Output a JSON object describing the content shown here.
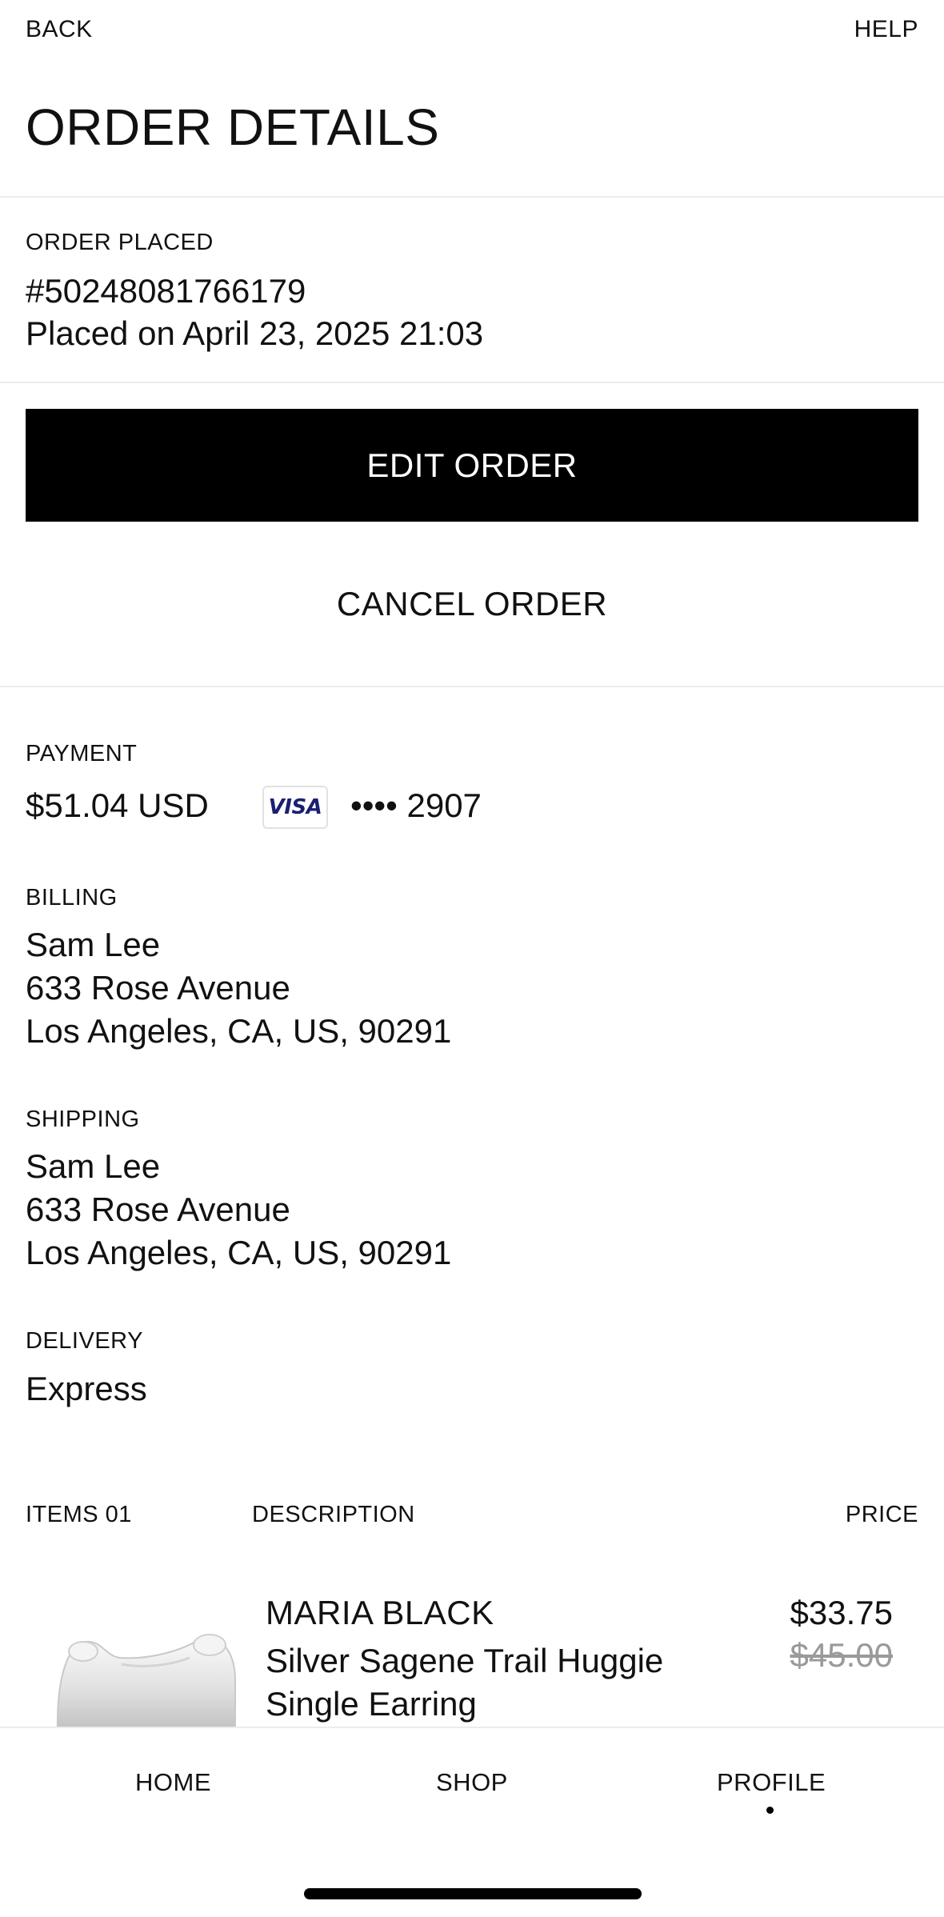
{
  "header": {
    "back_label": "BACK",
    "help_label": "HELP",
    "title": "ORDER DETAILS"
  },
  "order": {
    "section_label": "ORDER PLACED",
    "number": "#50248081766179",
    "placed_on": "Placed on April 23, 2025 21:03"
  },
  "actions": {
    "edit_label": "EDIT ORDER",
    "cancel_label": "CANCEL ORDER"
  },
  "payment": {
    "section_label": "PAYMENT",
    "amount": "$51.04 USD",
    "card_brand": "VISA",
    "card_number": "•••• 2907",
    "brand_color": "#1a1f71"
  },
  "billing": {
    "section_label": "BILLING",
    "name": "Sam Lee",
    "street": "633 Rose Avenue",
    "city_line": "Los Angeles, CA, US, 90291"
  },
  "shipping": {
    "section_label": "SHIPPING",
    "name": "Sam Lee",
    "street": "633 Rose Avenue",
    "city_line": "Los Angeles, CA, US, 90291"
  },
  "delivery": {
    "section_label": "DELIVERY",
    "method": "Express"
  },
  "items": {
    "col_items": "ITEMS 01",
    "col_description": "DESCRIPTION",
    "col_price": "PRICE",
    "list": [
      {
        "brand": "MARIA BLACK",
        "name_line1": "Silver Sagene Trail Huggie",
        "name_line2": "Single Earring",
        "price": "$33.75",
        "original_price": "$45.00",
        "image_icon": "earring-image"
      }
    ]
  },
  "bottom_nav": {
    "home_label": "HOME",
    "shop_label": "SHOP",
    "profile_label": "PROFILE",
    "active": "PROFILE"
  }
}
